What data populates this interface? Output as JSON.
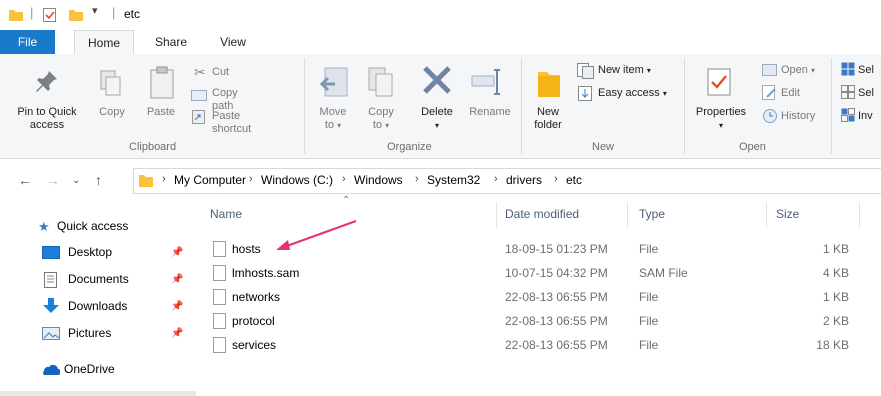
{
  "window": {
    "title": "etc"
  },
  "tabs": [
    {
      "label": "File"
    },
    {
      "label": "Home"
    },
    {
      "label": "Share"
    },
    {
      "label": "View"
    }
  ],
  "ribbon": {
    "clipboard": {
      "pin_label_1": "Pin to Quick",
      "pin_label_2": "access",
      "copy": "Copy",
      "paste": "Paste",
      "cut": "Cut",
      "copy_path": "Copy path",
      "paste_shortcut": "Paste shortcut",
      "group": "Clipboard"
    },
    "organize": {
      "move": "Move",
      "move_to": "to",
      "copy": "Copy",
      "copy_to": "to",
      "delete": "Delete",
      "rename": "Rename",
      "group": "Organize"
    },
    "new": {
      "new_folder_1": "New",
      "new_folder_2": "folder",
      "new_item": "New item",
      "easy_access": "Easy access",
      "group": "New"
    },
    "open": {
      "properties": "Properties",
      "open": "Open",
      "edit": "Edit",
      "history": "History",
      "group": "Open"
    },
    "select": {
      "sel1": "Sel",
      "sel2": "Sel",
      "inv": "Inv"
    }
  },
  "address": {
    "crumbs": [
      "My Computer",
      "Windows (C:)",
      "Windows",
      "System32",
      "drivers",
      "etc"
    ]
  },
  "nav_pane": {
    "quick_access": "Quick access",
    "items": [
      {
        "label": "Desktop",
        "icon": "desktop-icon"
      },
      {
        "label": "Documents",
        "icon": "documents-icon"
      },
      {
        "label": "Downloads",
        "icon": "downloads-icon"
      },
      {
        "label": "Pictures",
        "icon": "pictures-icon"
      }
    ],
    "onedrive": "OneDrive"
  },
  "file_list": {
    "columns": {
      "name": "Name",
      "date": "Date modified",
      "type": "Type",
      "size": "Size"
    },
    "rows": [
      {
        "name": "hosts",
        "date": "18-09-15 01:23 PM",
        "type": "File",
        "size": "1 KB"
      },
      {
        "name": "lmhosts.sam",
        "date": "10-07-15 04:32 PM",
        "type": "SAM File",
        "size": "4 KB"
      },
      {
        "name": "networks",
        "date": "22-08-13 06:55 PM",
        "type": "File",
        "size": "1 KB"
      },
      {
        "name": "protocol",
        "date": "22-08-13 06:55 PM",
        "type": "File",
        "size": "2 KB"
      },
      {
        "name": "services",
        "date": "22-08-13 06:55 PM",
        "type": "File",
        "size": "18 KB"
      }
    ]
  },
  "colors": {
    "file_tab": "#1979ca",
    "folder": "#f8c23c",
    "arrow": "#e5336b",
    "accent_blue": "#1979ca"
  }
}
